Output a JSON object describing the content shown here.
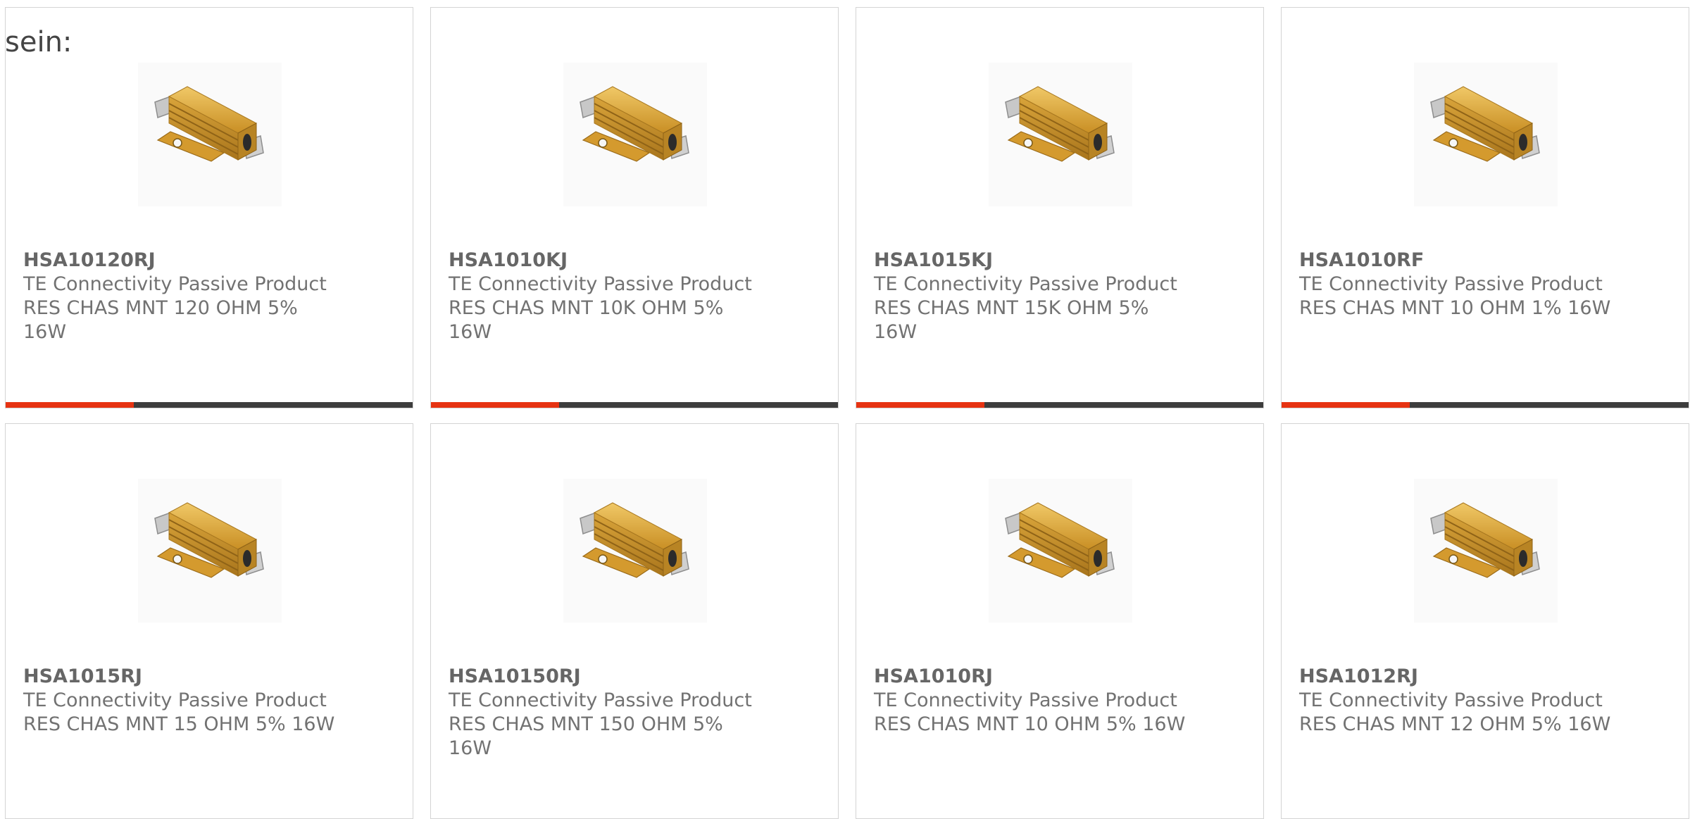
{
  "intro_text": "sein:",
  "products": [
    {
      "part": "HSA10120RJ",
      "manufacturer": "TE Connectivity Passive Product",
      "description": "RES CHAS MNT 120 OHM 5% 16W",
      "image": "chassis-resistor-image"
    },
    {
      "part": "HSA1010KJ",
      "manufacturer": "TE Connectivity Passive Product",
      "description": "RES CHAS MNT 10K OHM 5% 16W",
      "image": "chassis-resistor-image"
    },
    {
      "part": "HSA1015KJ",
      "manufacturer": "TE Connectivity Passive Product",
      "description": "RES CHAS MNT 15K OHM 5% 16W",
      "image": "chassis-resistor-image"
    },
    {
      "part": "HSA1010RF",
      "manufacturer": "TE Connectivity Passive Product",
      "description": "RES CHAS MNT 10 OHM 1% 16W",
      "image": "chassis-resistor-image"
    },
    {
      "part": "HSA1015RJ",
      "manufacturer": "TE Connectivity Passive Product",
      "description": "RES CHAS MNT 15 OHM 5% 16W",
      "image": "chassis-resistor-image"
    },
    {
      "part": "HSA10150RJ",
      "manufacturer": "TE Connectivity Passive Product",
      "description": "RES CHAS MNT 150 OHM 5% 16W",
      "image": "chassis-resistor-image"
    },
    {
      "part": "HSA1010RJ",
      "manufacturer": "TE Connectivity Passive Product",
      "description": "RES CHAS MNT 10 OHM 5% 16W",
      "image": "chassis-resistor-image"
    },
    {
      "part": "HSA1012RJ",
      "manufacturer": "TE Connectivity Passive Product",
      "description": "RES CHAS MNT 12 OHM 5% 16W",
      "image": "chassis-resistor-image"
    }
  ],
  "colors": {
    "accent": "#e63312",
    "bar": "#3d3d3d",
    "text": "#727272",
    "border": "#d4d4d4",
    "gold": "#d9a63c"
  }
}
